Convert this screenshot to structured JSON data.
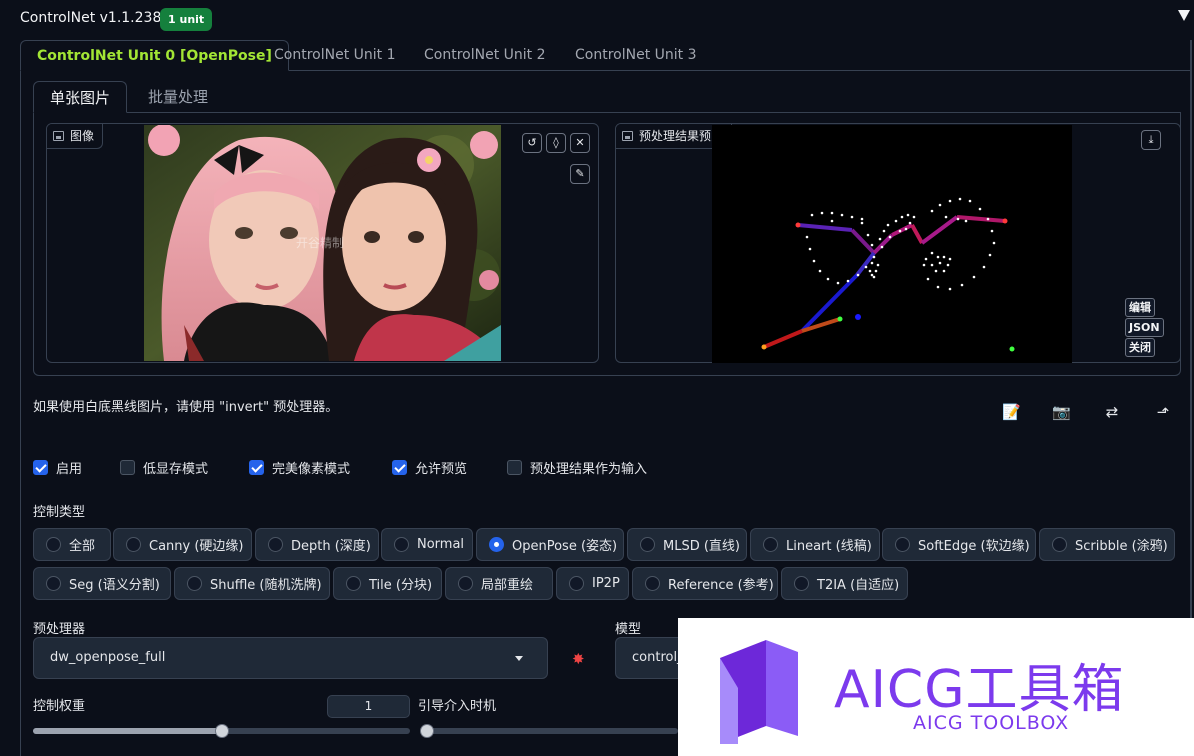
{
  "header": {
    "title": "ControlNet v1.1.238",
    "badge": "1 unit"
  },
  "unit_tabs": [
    {
      "label": "ControlNet Unit 0 [OpenPose]",
      "active": true
    },
    {
      "label": "ControlNet Unit 1",
      "active": false
    },
    {
      "label": "ControlNet Unit 2",
      "active": false
    },
    {
      "label": "ControlNet Unit 3",
      "active": false
    }
  ],
  "image_tabs": [
    {
      "label": "单张图片",
      "active": true
    },
    {
      "label": "批量处理",
      "active": false
    }
  ],
  "input_image": {
    "label": "图像",
    "watermark": "开谷精制",
    "tools": [
      "undo-icon",
      "eraser-icon",
      "close-icon",
      "brush-icon"
    ]
  },
  "preview": {
    "label": "预处理结果预览",
    "buttons": [
      "编辑",
      "JSON",
      "关闭"
    ]
  },
  "hint": "如果使用白底黑线图片，请使用 \"invert\" 预处理器。",
  "actions": [
    "edit-icon",
    "camera-icon",
    "swap-icon",
    "send-icon"
  ],
  "options": [
    {
      "label": "启用",
      "checked": true
    },
    {
      "label": "低显存模式",
      "checked": false
    },
    {
      "label": "完美像素模式",
      "checked": true
    },
    {
      "label": "允许预览",
      "checked": true
    },
    {
      "label": "预处理结果作为输入",
      "checked": false
    }
  ],
  "control_type": {
    "label": "控制类型",
    "row1": [
      {
        "label": "全部",
        "selected": false
      },
      {
        "label": "Canny (硬边缘)",
        "selected": false
      },
      {
        "label": "Depth (深度)",
        "selected": false
      },
      {
        "label": "Normal",
        "selected": false
      },
      {
        "label": "OpenPose (姿态)",
        "selected": true
      },
      {
        "label": "MLSD (直线)",
        "selected": false
      },
      {
        "label": "Lineart (线稿)",
        "selected": false
      },
      {
        "label": "SoftEdge (软边缘)",
        "selected": false
      },
      {
        "label": "Scribble (涂鸦)",
        "selected": false
      }
    ],
    "row2": [
      {
        "label": "Seg (语义分割)",
        "selected": false
      },
      {
        "label": "Shuffle (随机洗牌)",
        "selected": false
      },
      {
        "label": "Tile (分块)",
        "selected": false
      },
      {
        "label": "局部重绘",
        "selected": false
      },
      {
        "label": "IP2P",
        "selected": false
      },
      {
        "label": "Reference (参考)",
        "selected": false
      },
      {
        "label": "T2IA (自适应)",
        "selected": false
      }
    ]
  },
  "preprocessor": {
    "label": "预处理器",
    "value": "dw_openpose_full",
    "run_icon": "explosion-icon"
  },
  "model": {
    "label": "模型",
    "value": "control_"
  },
  "control_weight": {
    "label": "控制权重",
    "value": "1",
    "fraction": 0.5
  },
  "guidance_start": {
    "label": "引导介入时机",
    "fraction": 0
  },
  "brand": {
    "main": "AICG工具箱",
    "sub": "AICG TOOLBOX",
    "color": "#7c3aed"
  }
}
